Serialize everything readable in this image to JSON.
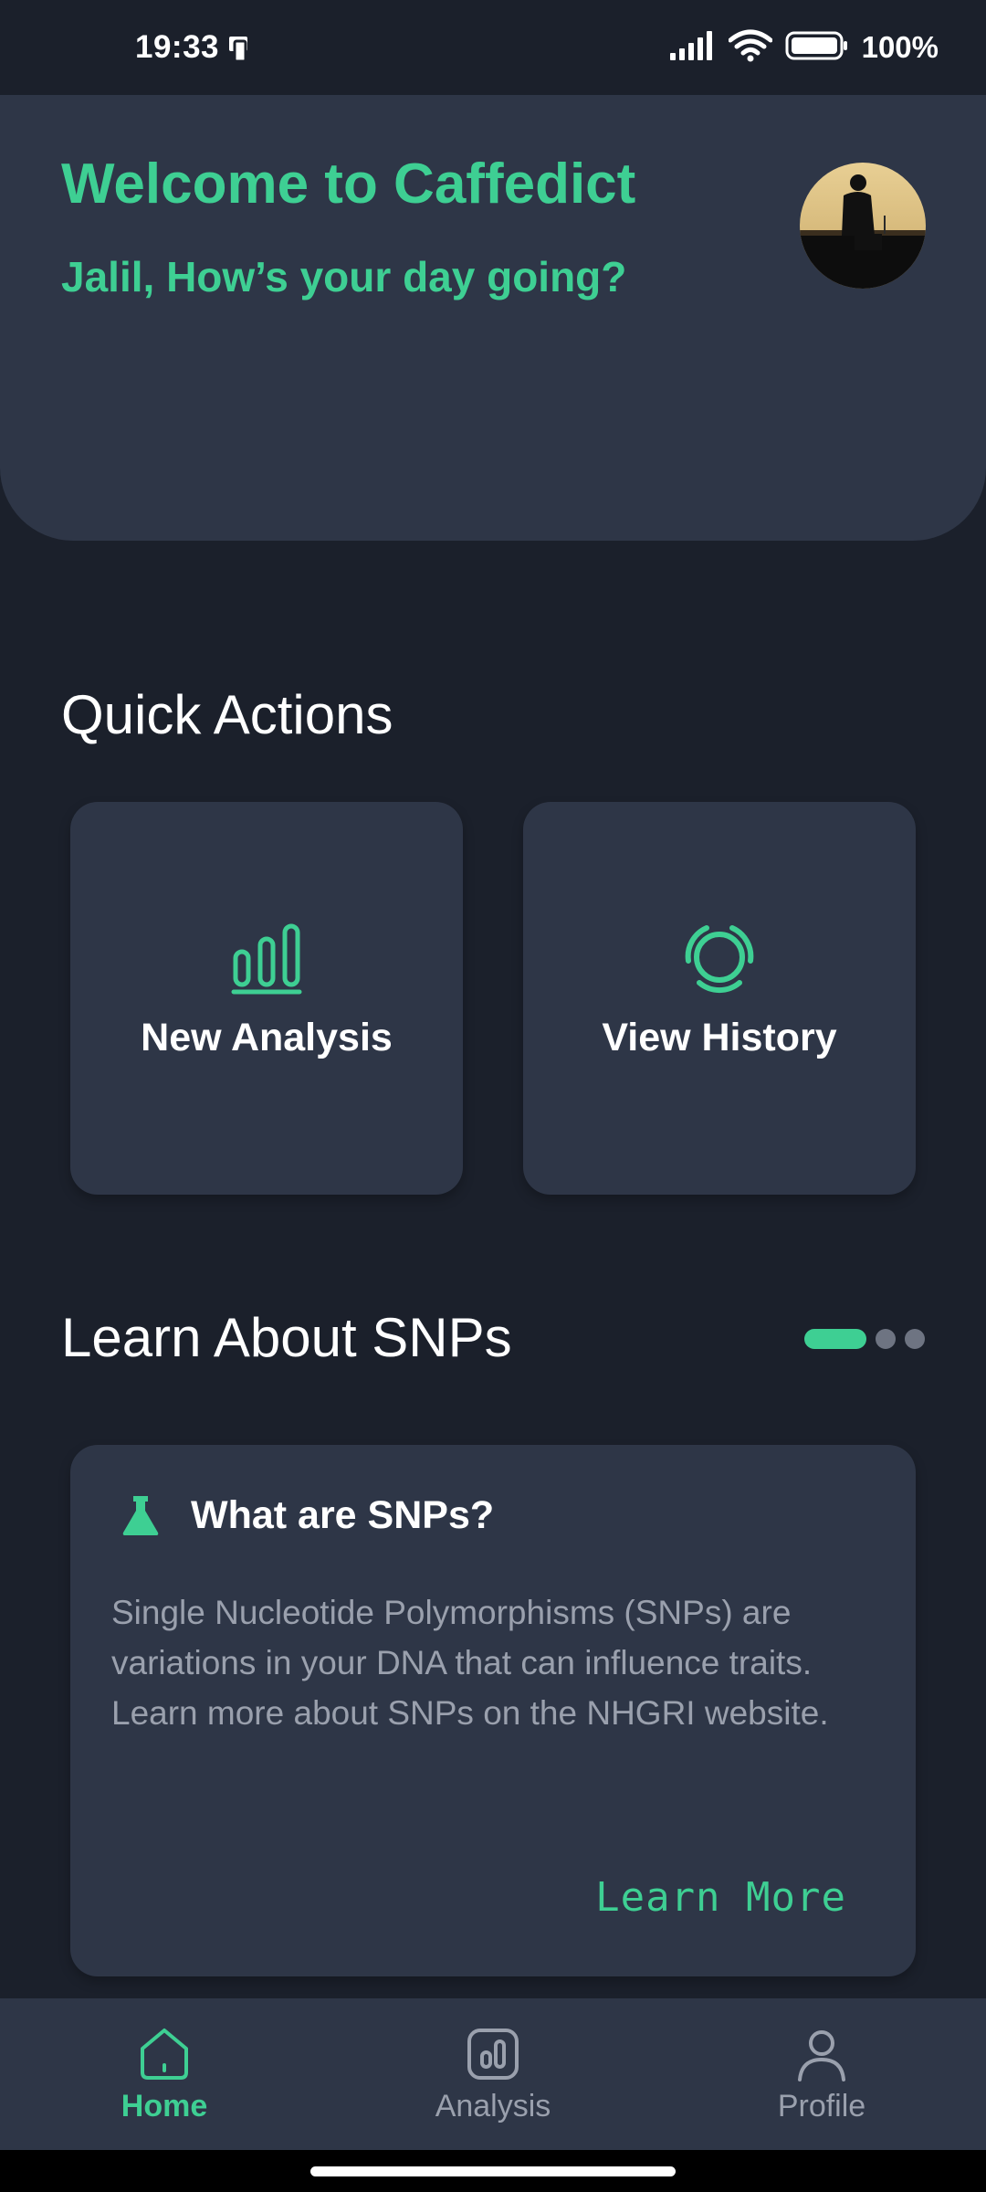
{
  "status_bar": {
    "time": "19:33",
    "battery": "100%"
  },
  "header": {
    "title": "Welcome to Caffedict",
    "subtitle": "Jalil, How’s your day going?"
  },
  "quick_actions": {
    "title": "Quick Actions",
    "items": [
      {
        "label": "New Analysis",
        "icon": "bar-chart-icon"
      },
      {
        "label": "View History",
        "icon": "history-ring-icon"
      }
    ]
  },
  "learn": {
    "title": "Learn About SNPs",
    "pager": {
      "count": 3,
      "active_index": 0
    },
    "card": {
      "icon": "flask-icon",
      "title": "What are SNPs?",
      "body": "Single Nucleotide Polymorphisms (SNPs) are variations in your DNA that can influence traits. Learn more about SNPs on the NHGRI website.",
      "link": "Learn More"
    }
  },
  "bottom_nav": {
    "items": [
      {
        "label": "Home",
        "icon": "home-icon",
        "active": true
      },
      {
        "label": "Analysis",
        "icon": "analysis-icon",
        "active": false
      },
      {
        "label": "Profile",
        "icon": "profile-icon",
        "active": false
      }
    ]
  },
  "colors": {
    "background": "#1b202b",
    "surface": "#2e3647",
    "accent": "#3ecf93",
    "muted_text": "#9aa0ad"
  }
}
